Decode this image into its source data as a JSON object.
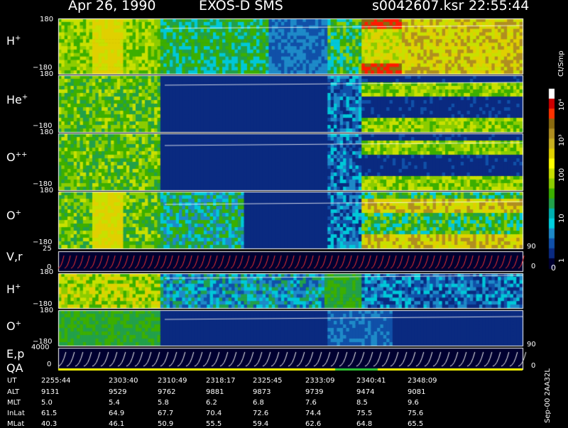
{
  "header": {
    "date": "Apr 26, 1990",
    "mission": "EXOS-D SMS",
    "file": "s0042607.ksr",
    "time": "22:55:44"
  },
  "panel_labels": [
    {
      "base": "H",
      "sup": "+"
    },
    {
      "base": "He",
      "sup": "+"
    },
    {
      "base": "O",
      "sup": "++"
    },
    {
      "base": "O",
      "sup": "+"
    },
    {
      "base": "V,r",
      "sup": ""
    },
    {
      "base": "H",
      "sup": "+"
    },
    {
      "base": "O",
      "sup": "+"
    },
    {
      "base": "E,p",
      "sup": ""
    },
    {
      "base": "QA",
      "sup": ""
    }
  ],
  "ticks": {
    "p1_top": "180",
    "p1_bot": "−180",
    "p2_top": "180",
    "p2_bot": "−180",
    "p3_top": "180",
    "p3_bot": "−180",
    "p4_top": "180",
    "p4_bot": "−180",
    "p5_top": "25",
    "p5_mid": "0",
    "p6_top": "180",
    "p6_bot": "−180",
    "p7_top": "180",
    "p7_bot": "−180",
    "p8_top": "4000",
    "p8_mid": "0",
    "right_90a": "90",
    "right_0a": "0",
    "right_90b": "90",
    "right_0b": "0"
  },
  "colorbar": {
    "unit": "Ct/Smp",
    "labels": [
      "10⁴",
      "10³",
      "100",
      "10",
      "1",
      "0"
    ],
    "colors": [
      "#ffffff",
      "#cc0000",
      "#ff3300",
      "#8a6a10",
      "#b08f20",
      "#c8b020",
      "#e0d000",
      "#ffff00",
      "#c8e000",
      "#8ccc00",
      "#3caf00",
      "#22a04a",
      "#00b0b0",
      "#00d0e0",
      "#1e8ac8",
      "#1050a8",
      "#0a2a80",
      "#000030"
    ]
  },
  "footer_note": "Sep-00 2AA32L",
  "ut_table": {
    "row_labels": [
      "UT",
      "ALT",
      "MLT",
      "InLat",
      "MLat"
    ],
    "columns": [
      [
        "2255:44",
        "9131",
        "5.0",
        "61.5",
        "40.3"
      ],
      [
        "2303:40",
        "9529",
        "5.4",
        "64.9",
        "46.1"
      ],
      [
        "2310:49",
        "9762",
        "5.8",
        "67.7",
        "50.9"
      ],
      [
        "2318:17",
        "9881",
        "6.2",
        "70.4",
        "55.5"
      ],
      [
        "2325:45",
        "9873",
        "6.8",
        "72.6",
        "59.4"
      ],
      [
        "2333:09",
        "9739",
        "7.6",
        "74.4",
        "62.6"
      ],
      [
        "2340:41",
        "9474",
        "8.5",
        "75.5",
        "64.8"
      ],
      [
        "2348:09",
        "9081",
        "9.6",
        "75.6",
        "65.5"
      ]
    ]
  },
  "chart_data": {
    "type": "heatmap",
    "x_ut_ticks": [
      "2255:44",
      "2303:40",
      "2310:49",
      "2318:17",
      "2325:45",
      "2333:09",
      "2340:41",
      "2348:09"
    ],
    "color_scale_unit": "Ct/Smp",
    "color_scale_ticks": [
      "1",
      "10",
      "100",
      "10³",
      "10⁴"
    ],
    "panels": [
      {
        "species": "H+",
        "y_range": [
          -180,
          180
        ]
      },
      {
        "species": "He+",
        "y_range": [
          -180,
          180
        ]
      },
      {
        "species": "O++",
        "y_range": [
          -180,
          180
        ]
      },
      {
        "species": "O+",
        "y_range": [
          -180,
          180
        ]
      },
      {
        "species": "V,r",
        "y_range": [
          0,
          25
        ]
      },
      {
        "species": "H+",
        "y_range": [
          -180,
          180
        ]
      },
      {
        "species": "O+",
        "y_range": [
          -180,
          180
        ]
      },
      {
        "species": "E,p / QA",
        "y_range": [
          0,
          4000
        ]
      }
    ]
  }
}
